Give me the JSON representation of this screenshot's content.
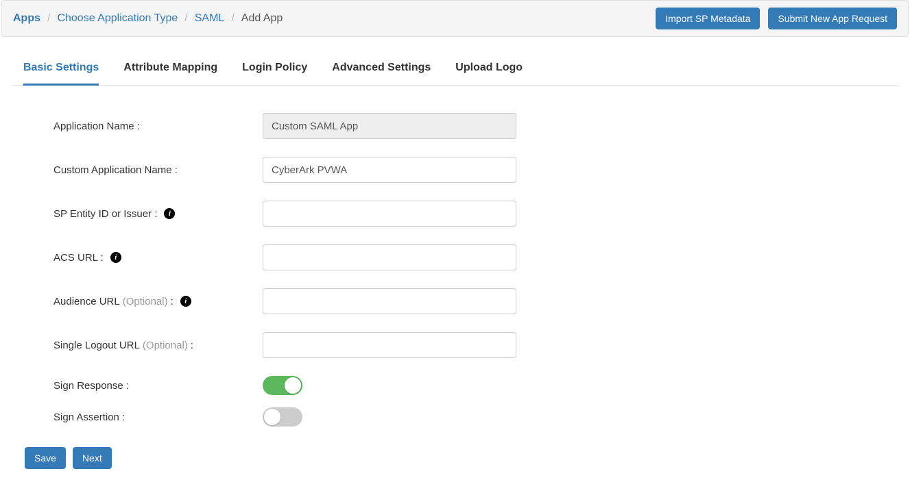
{
  "breadcrumb": {
    "apps": "Apps",
    "choose_type": "Choose Application Type",
    "saml": "SAML",
    "current": "Add App"
  },
  "top_actions": {
    "import": "Import SP Metadata",
    "submit": "Submit New App Request"
  },
  "tabs": {
    "basic": "Basic Settings",
    "attr": "Attribute Mapping",
    "login": "Login Policy",
    "advanced": "Advanced Settings",
    "logo": "Upload Logo"
  },
  "form": {
    "app_name_label": "Application Name :",
    "app_name_value": "Custom SAML App",
    "custom_name_label": "Custom Application Name :",
    "custom_name_value": "CyberArk PVWA",
    "sp_entity_label": "SP Entity ID or Issuer :",
    "sp_entity_value": "",
    "acs_label": "ACS URL :",
    "acs_value": "",
    "audience_label_pre": "Audience URL ",
    "audience_optional": "(Optional)",
    "audience_label_post": " :",
    "audience_value": "",
    "slo_label_pre": "Single Logout URL ",
    "slo_optional": "(Optional)",
    "slo_label_post": " :",
    "slo_value": "",
    "sign_response_label": "Sign Response :",
    "sign_assertion_label": "Sign Assertion :"
  },
  "toggles": {
    "sign_response": true,
    "sign_assertion": false
  },
  "footer": {
    "save": "Save",
    "next": "Next"
  }
}
